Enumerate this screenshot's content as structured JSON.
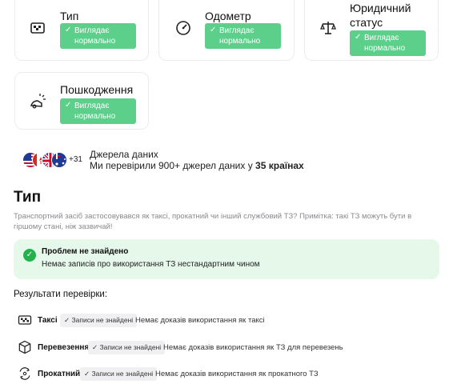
{
  "cards": [
    {
      "title": "Тип",
      "icon": "taxi-icon",
      "status": "Виглядає нормально"
    },
    {
      "title": "Одометр",
      "icon": "odometer-icon",
      "status": "Виглядає нормально"
    },
    {
      "title": "Юридичний статус",
      "icon": "scales-icon",
      "status": "Виглядає нормально"
    },
    {
      "title": "Пошкодження",
      "icon": "crash-icon",
      "status": "Виглядає нормально"
    }
  ],
  "sources": {
    "more": "+31",
    "title": "Джерела даних",
    "subtitle_prefix": "Ми перевірили 900+ джерел даних у ",
    "subtitle_bold": "35 країнах"
  },
  "section": {
    "title": "Тип",
    "description": "Транспортний засіб застосовувався як таксі, прокатний чи інший службовий ТЗ? Примітка: такі ТЗ можуть бути в гіршому стані, ніж зазвичай!"
  },
  "ok_box": {
    "title": "Проблем не знайдено",
    "subtitle": "Немає записів про використання ТЗ нестандартним чином"
  },
  "results": {
    "title": "Результати перевірки:",
    "rows": [
      {
        "name": "Таксі",
        "icon": "taxi-icon",
        "pill": "Записи не знайдені",
        "note": "Немає доказів використання як таксі"
      },
      {
        "name": "Перевезення",
        "icon": "box-icon",
        "pill": "Записи не знайдені",
        "note": "Немає доказів використання як ТЗ для перевезень"
      },
      {
        "name": "Прокатний",
        "icon": "rental-icon",
        "pill": "Записи не знайдені",
        "note": "Немає доказів використання як прокатного ТЗ"
      }
    ]
  },
  "colors": {
    "badge": "#5cd08a",
    "ok_bg": "#e5f8ea",
    "ok_icon": "#22b14c"
  }
}
